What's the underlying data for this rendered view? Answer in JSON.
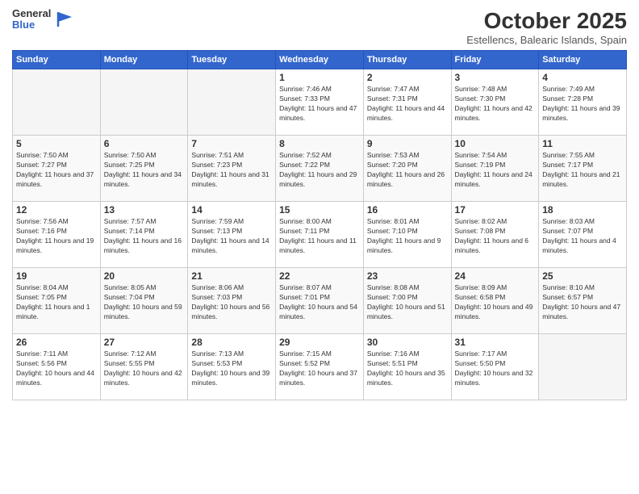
{
  "header": {
    "logo_general": "General",
    "logo_blue": "Blue",
    "month": "October 2025",
    "location": "Estellencs, Balearic Islands, Spain"
  },
  "weekdays": [
    "Sunday",
    "Monday",
    "Tuesday",
    "Wednesday",
    "Thursday",
    "Friday",
    "Saturday"
  ],
  "weeks": [
    [
      {
        "day": "",
        "empty": true
      },
      {
        "day": "",
        "empty": true
      },
      {
        "day": "",
        "empty": true
      },
      {
        "day": "1",
        "sunrise": "7:46 AM",
        "sunset": "7:33 PM",
        "daylight": "11 hours and 47 minutes."
      },
      {
        "day": "2",
        "sunrise": "7:47 AM",
        "sunset": "7:31 PM",
        "daylight": "11 hours and 44 minutes."
      },
      {
        "day": "3",
        "sunrise": "7:48 AM",
        "sunset": "7:30 PM",
        "daylight": "11 hours and 42 minutes."
      },
      {
        "day": "4",
        "sunrise": "7:49 AM",
        "sunset": "7:28 PM",
        "daylight": "11 hours and 39 minutes."
      }
    ],
    [
      {
        "day": "5",
        "sunrise": "7:50 AM",
        "sunset": "7:27 PM",
        "daylight": "11 hours and 37 minutes."
      },
      {
        "day": "6",
        "sunrise": "7:50 AM",
        "sunset": "7:25 PM",
        "daylight": "11 hours and 34 minutes."
      },
      {
        "day": "7",
        "sunrise": "7:51 AM",
        "sunset": "7:23 PM",
        "daylight": "11 hours and 31 minutes."
      },
      {
        "day": "8",
        "sunrise": "7:52 AM",
        "sunset": "7:22 PM",
        "daylight": "11 hours and 29 minutes."
      },
      {
        "day": "9",
        "sunrise": "7:53 AM",
        "sunset": "7:20 PM",
        "daylight": "11 hours and 26 minutes."
      },
      {
        "day": "10",
        "sunrise": "7:54 AM",
        "sunset": "7:19 PM",
        "daylight": "11 hours and 24 minutes."
      },
      {
        "day": "11",
        "sunrise": "7:55 AM",
        "sunset": "7:17 PM",
        "daylight": "11 hours and 21 minutes."
      }
    ],
    [
      {
        "day": "12",
        "sunrise": "7:56 AM",
        "sunset": "7:16 PM",
        "daylight": "11 hours and 19 minutes."
      },
      {
        "day": "13",
        "sunrise": "7:57 AM",
        "sunset": "7:14 PM",
        "daylight": "11 hours and 16 minutes."
      },
      {
        "day": "14",
        "sunrise": "7:59 AM",
        "sunset": "7:13 PM",
        "daylight": "11 hours and 14 minutes."
      },
      {
        "day": "15",
        "sunrise": "8:00 AM",
        "sunset": "7:11 PM",
        "daylight": "11 hours and 11 minutes."
      },
      {
        "day": "16",
        "sunrise": "8:01 AM",
        "sunset": "7:10 PM",
        "daylight": "11 hours and 9 minutes."
      },
      {
        "day": "17",
        "sunrise": "8:02 AM",
        "sunset": "7:08 PM",
        "daylight": "11 hours and 6 minutes."
      },
      {
        "day": "18",
        "sunrise": "8:03 AM",
        "sunset": "7:07 PM",
        "daylight": "11 hours and 4 minutes."
      }
    ],
    [
      {
        "day": "19",
        "sunrise": "8:04 AM",
        "sunset": "7:05 PM",
        "daylight": "11 hours and 1 minute."
      },
      {
        "day": "20",
        "sunrise": "8:05 AM",
        "sunset": "7:04 PM",
        "daylight": "10 hours and 59 minutes."
      },
      {
        "day": "21",
        "sunrise": "8:06 AM",
        "sunset": "7:03 PM",
        "daylight": "10 hours and 56 minutes."
      },
      {
        "day": "22",
        "sunrise": "8:07 AM",
        "sunset": "7:01 PM",
        "daylight": "10 hours and 54 minutes."
      },
      {
        "day": "23",
        "sunrise": "8:08 AM",
        "sunset": "7:00 PM",
        "daylight": "10 hours and 51 minutes."
      },
      {
        "day": "24",
        "sunrise": "8:09 AM",
        "sunset": "6:58 PM",
        "daylight": "10 hours and 49 minutes."
      },
      {
        "day": "25",
        "sunrise": "8:10 AM",
        "sunset": "6:57 PM",
        "daylight": "10 hours and 47 minutes."
      }
    ],
    [
      {
        "day": "26",
        "sunrise": "7:11 AM",
        "sunset": "5:56 PM",
        "daylight": "10 hours and 44 minutes."
      },
      {
        "day": "27",
        "sunrise": "7:12 AM",
        "sunset": "5:55 PM",
        "daylight": "10 hours and 42 minutes."
      },
      {
        "day": "28",
        "sunrise": "7:13 AM",
        "sunset": "5:53 PM",
        "daylight": "10 hours and 39 minutes."
      },
      {
        "day": "29",
        "sunrise": "7:15 AM",
        "sunset": "5:52 PM",
        "daylight": "10 hours and 37 minutes."
      },
      {
        "day": "30",
        "sunrise": "7:16 AM",
        "sunset": "5:51 PM",
        "daylight": "10 hours and 35 minutes."
      },
      {
        "day": "31",
        "sunrise": "7:17 AM",
        "sunset": "5:50 PM",
        "daylight": "10 hours and 32 minutes."
      },
      {
        "day": "",
        "empty": true
      }
    ]
  ]
}
